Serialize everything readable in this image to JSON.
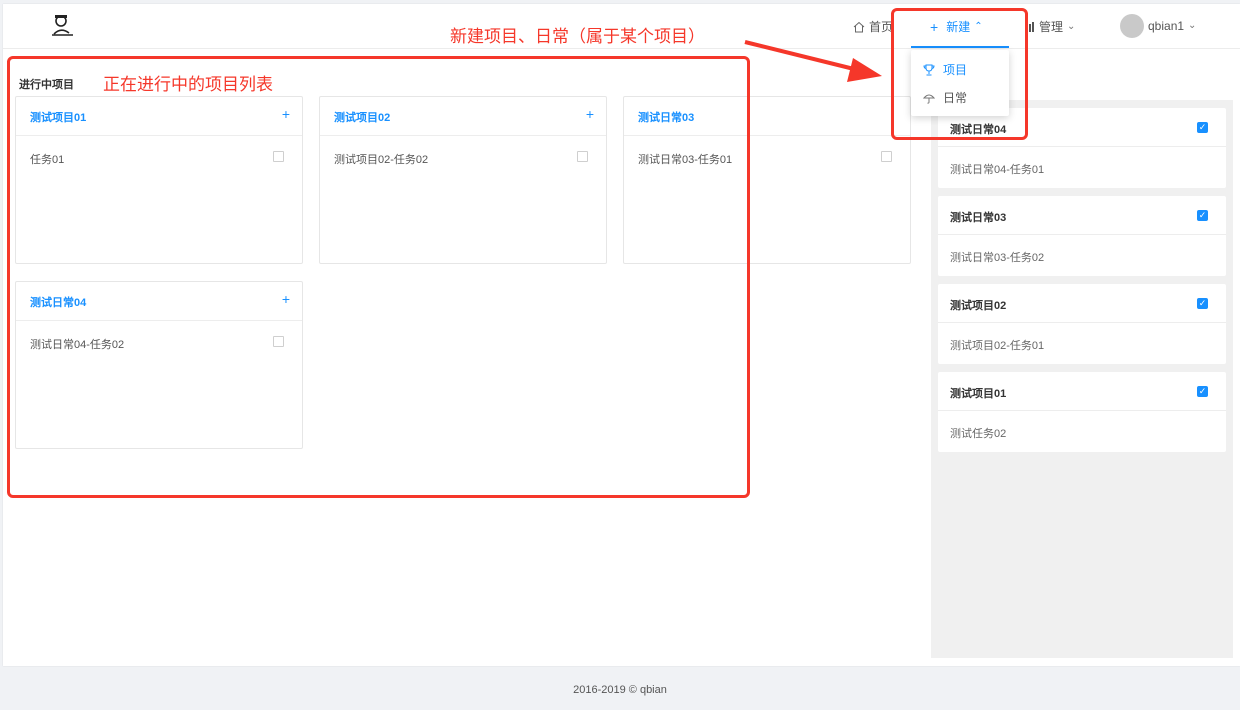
{
  "header": {
    "nav_home": "首页",
    "nav_new": "新建",
    "nav_manage": "管理",
    "user_name": "qbian1"
  },
  "dropdown": {
    "items": [
      {
        "label": "项目",
        "icon": "trophy-icon"
      },
      {
        "label": "日常",
        "icon": "umbrella-icon"
      }
    ]
  },
  "section_label": "进行中项目",
  "cards": [
    {
      "title": "测试项目01",
      "task": "任务01"
    },
    {
      "title": "测试项目02",
      "task": "测试项目02-任务02"
    },
    {
      "title": "测试日常03",
      "task": "测试日常03-任务01"
    },
    {
      "title": "测试日常04",
      "task": "测试日常04-任务02"
    }
  ],
  "right_cards": [
    {
      "title": "测试日常04",
      "task": "测试日常04-任务01"
    },
    {
      "title": "测试日常03",
      "task": "测试日常03-任务02"
    },
    {
      "title": "测试项目02",
      "task": "测试项目02-任务01"
    },
    {
      "title": "测试项目01",
      "task": "测试任务02"
    }
  ],
  "footer": "2016-2019 © qbian",
  "annotations": {
    "top": "新建项目、日常（属于某个项目）",
    "left": "正在进行中的项目列表"
  },
  "colors": {
    "accent": "#1890ff",
    "annotation": "#f5372a"
  }
}
